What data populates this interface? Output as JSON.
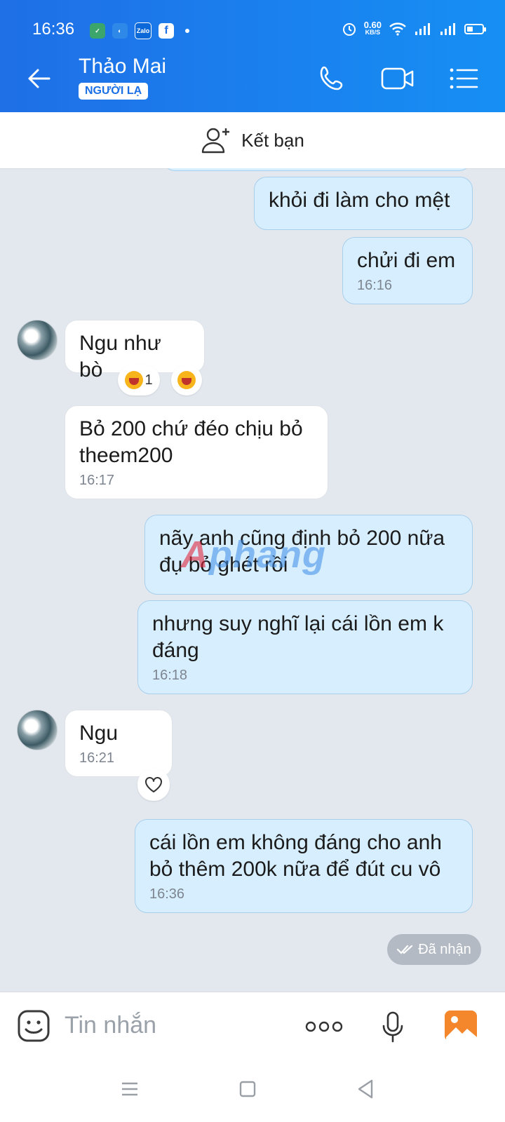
{
  "status": {
    "time": "16:36",
    "net_speed": "0.60",
    "net_unit": "KB/S",
    "app_icons": [
      "task-icon",
      "browser-icon",
      "zalo-icon",
      "facebook-icon"
    ]
  },
  "header": {
    "name": "Thảo Mai",
    "badge": "NGƯỜI LẠ"
  },
  "add_friend": {
    "label": "Kết bạn"
  },
  "messages": [
    {
      "text": "khỏi đi làm cho mệt"
    },
    {
      "text": "chửi đi em",
      "time": "16:16"
    },
    {
      "text": "Ngu như bò",
      "reaction_count": "1"
    },
    {
      "text": "Bỏ 200 chứ đéo chịu bỏ theem200",
      "time": "16:17"
    },
    {
      "text": "nãy anh cũng định bỏ 200 nữa đụ bỏ ghét rồi"
    },
    {
      "text": "nhưng suy nghĩ lại cái lồn em k đáng",
      "time": "16:18"
    },
    {
      "text": "Ngu",
      "time": "16:21"
    },
    {
      "text": "cái lồn em không đáng cho anh bỏ thêm 200k nữa để đút cu vô",
      "time": "16:36"
    }
  ],
  "delivery_status": "Đã nhận",
  "watermark": {
    "a": "A",
    "rest": "phang"
  },
  "input": {
    "placeholder": "Tin nhắn"
  },
  "colors": {
    "header": "#1f6fe6",
    "my_bubble": "#d7eefe",
    "their_bubble": "#ffffff",
    "background": "#e3e8ef"
  }
}
